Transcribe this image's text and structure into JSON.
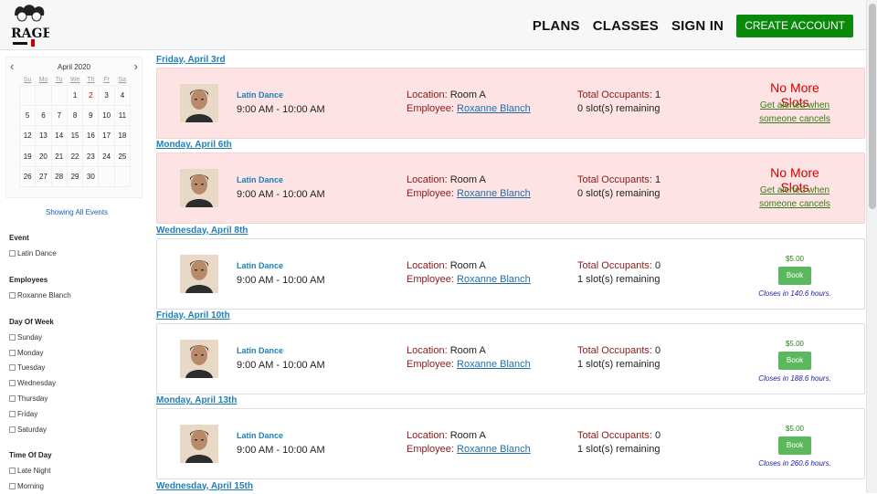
{
  "header": {
    "logo_text": "RAGE",
    "nav": [
      "PLANS",
      "CLASSES",
      "SIGN IN"
    ],
    "cta": "CREATE ACCOUNT"
  },
  "calendar": {
    "month": "April 2020",
    "weekdays": [
      "Su",
      "Mo",
      "Tu",
      "We",
      "Th",
      "Fr",
      "Sa"
    ],
    "weeks": [
      [
        "",
        "",
        "",
        "1",
        "2",
        "3",
        "4"
      ],
      [
        "5",
        "6",
        "7",
        "8",
        "9",
        "10",
        "11"
      ],
      [
        "12",
        "13",
        "14",
        "15",
        "16",
        "17",
        "18"
      ],
      [
        "19",
        "20",
        "21",
        "22",
        "23",
        "24",
        "25"
      ],
      [
        "26",
        "27",
        "28",
        "29",
        "30",
        "",
        ""
      ]
    ],
    "today": "2"
  },
  "filters": {
    "show_all": "Showing All Events",
    "event": {
      "heading": "Event",
      "options": [
        "Latin Dance"
      ]
    },
    "employees": {
      "heading": "Employees",
      "options": [
        "Roxanne Blanch"
      ]
    },
    "day_of_week": {
      "heading": "Day Of Week",
      "options": [
        "Sunday",
        "Monday",
        "Tuesday",
        "Wednesday",
        "Thursday",
        "Friday",
        "Saturday"
      ]
    },
    "time_of_day": {
      "heading": "Time Of Day",
      "options": [
        "Late Night",
        "Morning"
      ]
    }
  },
  "labels": {
    "location": "Location:",
    "employee": "Employee:",
    "occupants": "Total Occupants:",
    "no_more": "No More Slots",
    "alert_line1": "Get alerted when",
    "alert_line2": "someone cancels",
    "book": "Book"
  },
  "sessions": [
    {
      "day": "Friday, April 3rd",
      "name": "Latin Dance",
      "time": "9:00 AM - 10:00 AM",
      "location": "Room A",
      "employee": "Roxanne Blanch",
      "occupants": "1",
      "slots": "0 slot(s) remaining",
      "full": true,
      "price": "",
      "closes": ""
    },
    {
      "day": "Monday, April 6th",
      "name": "Latin Dance",
      "time": "9:00 AM - 10:00 AM",
      "location": "Room A",
      "employee": "Roxanne Blanch",
      "occupants": "1",
      "slots": "0 slot(s) remaining",
      "full": true,
      "price": "",
      "closes": ""
    },
    {
      "day": "Wednesday, April 8th",
      "name": "Latin Dance",
      "time": "9:00 AM - 10:00 AM",
      "location": "Room A",
      "employee": "Roxanne Blanch",
      "occupants": "0",
      "slots": "1 slot(s) remaining",
      "full": false,
      "price": "$5.00",
      "closes": "Closes in 140.6 hours."
    },
    {
      "day": "Friday, April 10th",
      "name": "Latin Dance",
      "time": "9:00 AM - 10:00 AM",
      "location": "Room A",
      "employee": "Roxanne Blanch",
      "occupants": "0",
      "slots": "1 slot(s) remaining",
      "full": false,
      "price": "$5.00",
      "closes": "Closes in 188.6 hours."
    },
    {
      "day": "Monday, April 13th",
      "name": "Latin Dance",
      "time": "9:00 AM - 10:00 AM",
      "location": "Room A",
      "employee": "Roxanne Blanch",
      "occupants": "0",
      "slots": "1 slot(s) remaining",
      "full": false,
      "price": "$5.00",
      "closes": "Closes in 260.6 hours."
    },
    {
      "day": "Wednesday, April 15th"
    }
  ]
}
